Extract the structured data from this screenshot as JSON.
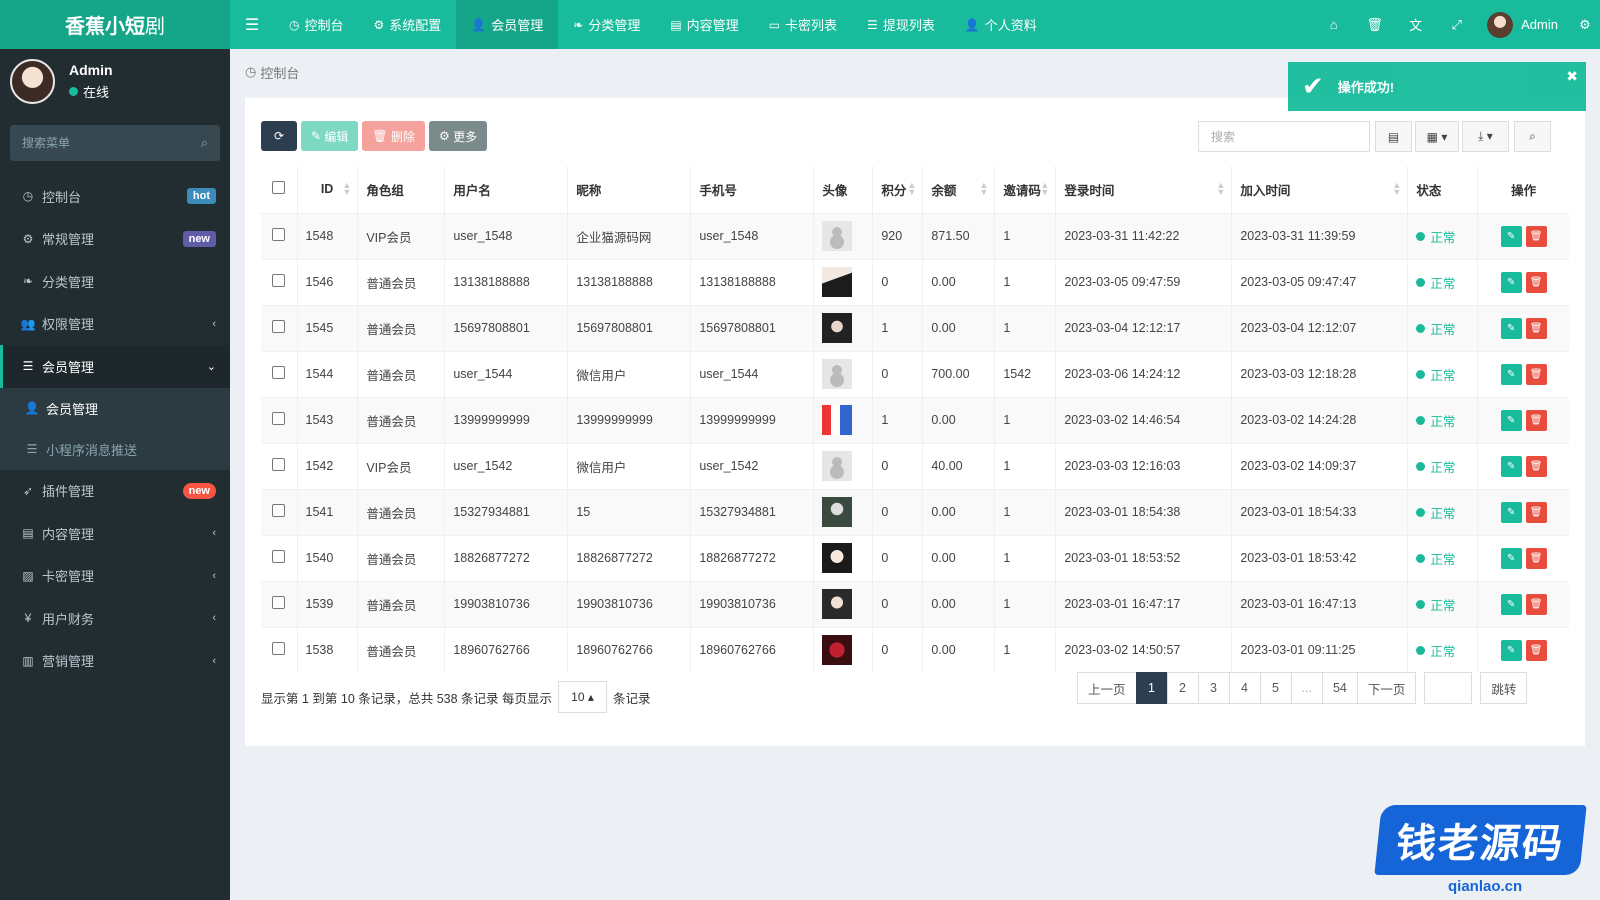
{
  "app": {
    "logo_bold": "香蕉小短",
    "logo_thin": "剧"
  },
  "topnav": [
    {
      "icon": "dashboard-icon",
      "glyph": "◷",
      "label": "控制台"
    },
    {
      "icon": "gear-icon",
      "glyph": "⚙",
      "label": "系统配置"
    },
    {
      "icon": "user-icon",
      "glyph": "👤",
      "label": "会员管理",
      "active": true
    },
    {
      "icon": "leaf-icon",
      "glyph": "❧",
      "label": "分类管理"
    },
    {
      "icon": "file-icon",
      "glyph": "▤",
      "label": "内容管理"
    },
    {
      "icon": "card-icon",
      "glyph": "▭",
      "label": "卡密列表"
    },
    {
      "icon": "list-icon",
      "glyph": "☰",
      "label": "提现列表"
    },
    {
      "icon": "user-icon",
      "glyph": "👤",
      "label": "个人资料"
    }
  ],
  "topright": {
    "user": "Admin"
  },
  "user": {
    "name": "Admin",
    "status": "在线"
  },
  "sidebar_search": {
    "placeholder": "搜索菜单"
  },
  "menu": [
    {
      "label": "控制台",
      "badge": "hot",
      "badge_color": "blue",
      "glyph": "◷",
      "icon": "dashboard-icon"
    },
    {
      "label": "常规管理",
      "badge": "new",
      "badge_color": "purple",
      "glyph": "⚙",
      "icon": "cogs-icon"
    },
    {
      "label": "分类管理",
      "glyph": "❧",
      "icon": "leaf-icon"
    },
    {
      "label": "权限管理",
      "chevron": "‹",
      "glyph": "👥",
      "icon": "group-icon"
    }
  ],
  "menu_open": {
    "label": "会员管理",
    "chevron": "⌄",
    "glyph": "☰",
    "icon": "list-icon"
  },
  "submenu": [
    {
      "label": "会员管理",
      "active": true,
      "glyph": "👤",
      "icon": "user-icon"
    },
    {
      "label": "小程序消息推送",
      "glyph": "☰",
      "icon": "list-icon"
    }
  ],
  "menu2": [
    {
      "label": "插件管理",
      "badge": "new",
      "badge_color": "red",
      "glyph": "➶",
      "icon": "rocket-icon"
    },
    {
      "label": "内容管理",
      "chevron": "‹",
      "glyph": "▤",
      "icon": "file-icon"
    },
    {
      "label": "卡密管理",
      "chevron": "‹",
      "glyph": "▨",
      "icon": "image-icon"
    },
    {
      "label": "用户财务",
      "chevron": "‹",
      "glyph": "¥",
      "icon": "yen-icon"
    },
    {
      "label": "营销管理",
      "chevron": "‹",
      "glyph": "▥",
      "icon": "chart-icon"
    }
  ],
  "breadcrumb": "控制台",
  "toolbar": {
    "edit": "编辑",
    "delete": "删除",
    "more": "更多"
  },
  "table_search": {
    "placeholder": "搜索"
  },
  "columns": [
    "ID",
    "角色组",
    "用户名",
    "昵称",
    "手机号",
    "头像",
    "积分",
    "余额",
    "邀请码",
    "登录时间",
    "加入时间",
    "状态",
    "操作"
  ],
  "rows": [
    {
      "id": "1548",
      "group": "VIP会员",
      "username": "user_1548",
      "nickname": "企业猫源码网",
      "mobile": "user_1548",
      "avatar": "default",
      "score": "920",
      "money": "871.50",
      "invite": "1",
      "logintime": "2023-03-31 11:42:22",
      "jointime": "2023-03-31 11:39:59",
      "status": "正常"
    },
    {
      "id": "1546",
      "group": "普通会员",
      "username": "13138188888",
      "nickname": "13138188888",
      "mobile": "13138188888",
      "avatar": "th-1",
      "score": "0",
      "money": "0.00",
      "invite": "1",
      "logintime": "2023-03-05 09:47:59",
      "jointime": "2023-03-05 09:47:47",
      "status": "正常"
    },
    {
      "id": "1545",
      "group": "普通会员",
      "username": "15697808801",
      "nickname": "15697808801",
      "mobile": "15697808801",
      "avatar": "th-2",
      "score": "1",
      "money": "0.00",
      "invite": "1",
      "logintime": "2023-03-04 12:12:17",
      "jointime": "2023-03-04 12:12:07",
      "status": "正常"
    },
    {
      "id": "1544",
      "group": "普通会员",
      "username": "user_1544",
      "nickname": "微信用户",
      "mobile": "user_1544",
      "avatar": "default",
      "score": "0",
      "money": "700.00",
      "invite": "1542",
      "logintime": "2023-03-06 14:24:12",
      "jointime": "2023-03-03 12:18:28",
      "status": "正常"
    },
    {
      "id": "1543",
      "group": "普通会员",
      "username": "13999999999",
      "nickname": "13999999999",
      "mobile": "13999999999",
      "avatar": "th-3",
      "score": "1",
      "money": "0.00",
      "invite": "1",
      "logintime": "2023-03-02 14:46:54",
      "jointime": "2023-03-02 14:24:28",
      "status": "正常"
    },
    {
      "id": "1542",
      "group": "VIP会员",
      "username": "user_1542",
      "nickname": "微信用户",
      "mobile": "user_1542",
      "avatar": "default",
      "score": "0",
      "money": "40.00",
      "invite": "1",
      "logintime": "2023-03-03 12:16:03",
      "jointime": "2023-03-02 14:09:37",
      "status": "正常"
    },
    {
      "id": "1541",
      "group": "普通会员",
      "username": "15327934881",
      "nickname": "15",
      "mobile": "15327934881",
      "avatar": "th-4",
      "score": "0",
      "money": "0.00",
      "invite": "1",
      "logintime": "2023-03-01 18:54:38",
      "jointime": "2023-03-01 18:54:33",
      "status": "正常"
    },
    {
      "id": "1540",
      "group": "普通会员",
      "username": "18826877272",
      "nickname": "18826877272",
      "mobile": "18826877272",
      "avatar": "th-5",
      "score": "0",
      "money": "0.00",
      "invite": "1",
      "logintime": "2023-03-01 18:53:52",
      "jointime": "2023-03-01 18:53:42",
      "status": "正常"
    },
    {
      "id": "1539",
      "group": "普通会员",
      "username": "19903810736",
      "nickname": "19903810736",
      "mobile": "19903810736",
      "avatar": "th-6",
      "score": "0",
      "money": "0.00",
      "invite": "1",
      "logintime": "2023-03-01 16:47:17",
      "jointime": "2023-03-01 16:47:13",
      "status": "正常"
    },
    {
      "id": "1538",
      "group": "普通会员",
      "username": "18960762766",
      "nickname": "18960762766",
      "mobile": "18960762766",
      "avatar": "th-7",
      "score": "0",
      "money": "0.00",
      "invite": "1",
      "logintime": "2023-03-02 14:50:57",
      "jointime": "2023-03-01 09:11:25",
      "status": "正常"
    }
  ],
  "footer": {
    "info": "显示第 1 到第 10 条记录，总共 538 条记录 每页显示",
    "pagesize": "10 ▴",
    "suffix": "条记录"
  },
  "pager": {
    "prev": "上一页",
    "pages": [
      "1",
      "2",
      "3",
      "4",
      "5",
      "...",
      "54"
    ],
    "current": "1",
    "next": "下一页",
    "jump": "跳转"
  },
  "toast": {
    "message": "操作成功!"
  },
  "watermark": {
    "text": "钱老源码",
    "url": "qianlao.cn"
  },
  "colors": {
    "brand": "#18bc9c",
    "sidebar": "#222d32",
    "danger": "#e74c3c",
    "dark": "#2c3e50"
  }
}
